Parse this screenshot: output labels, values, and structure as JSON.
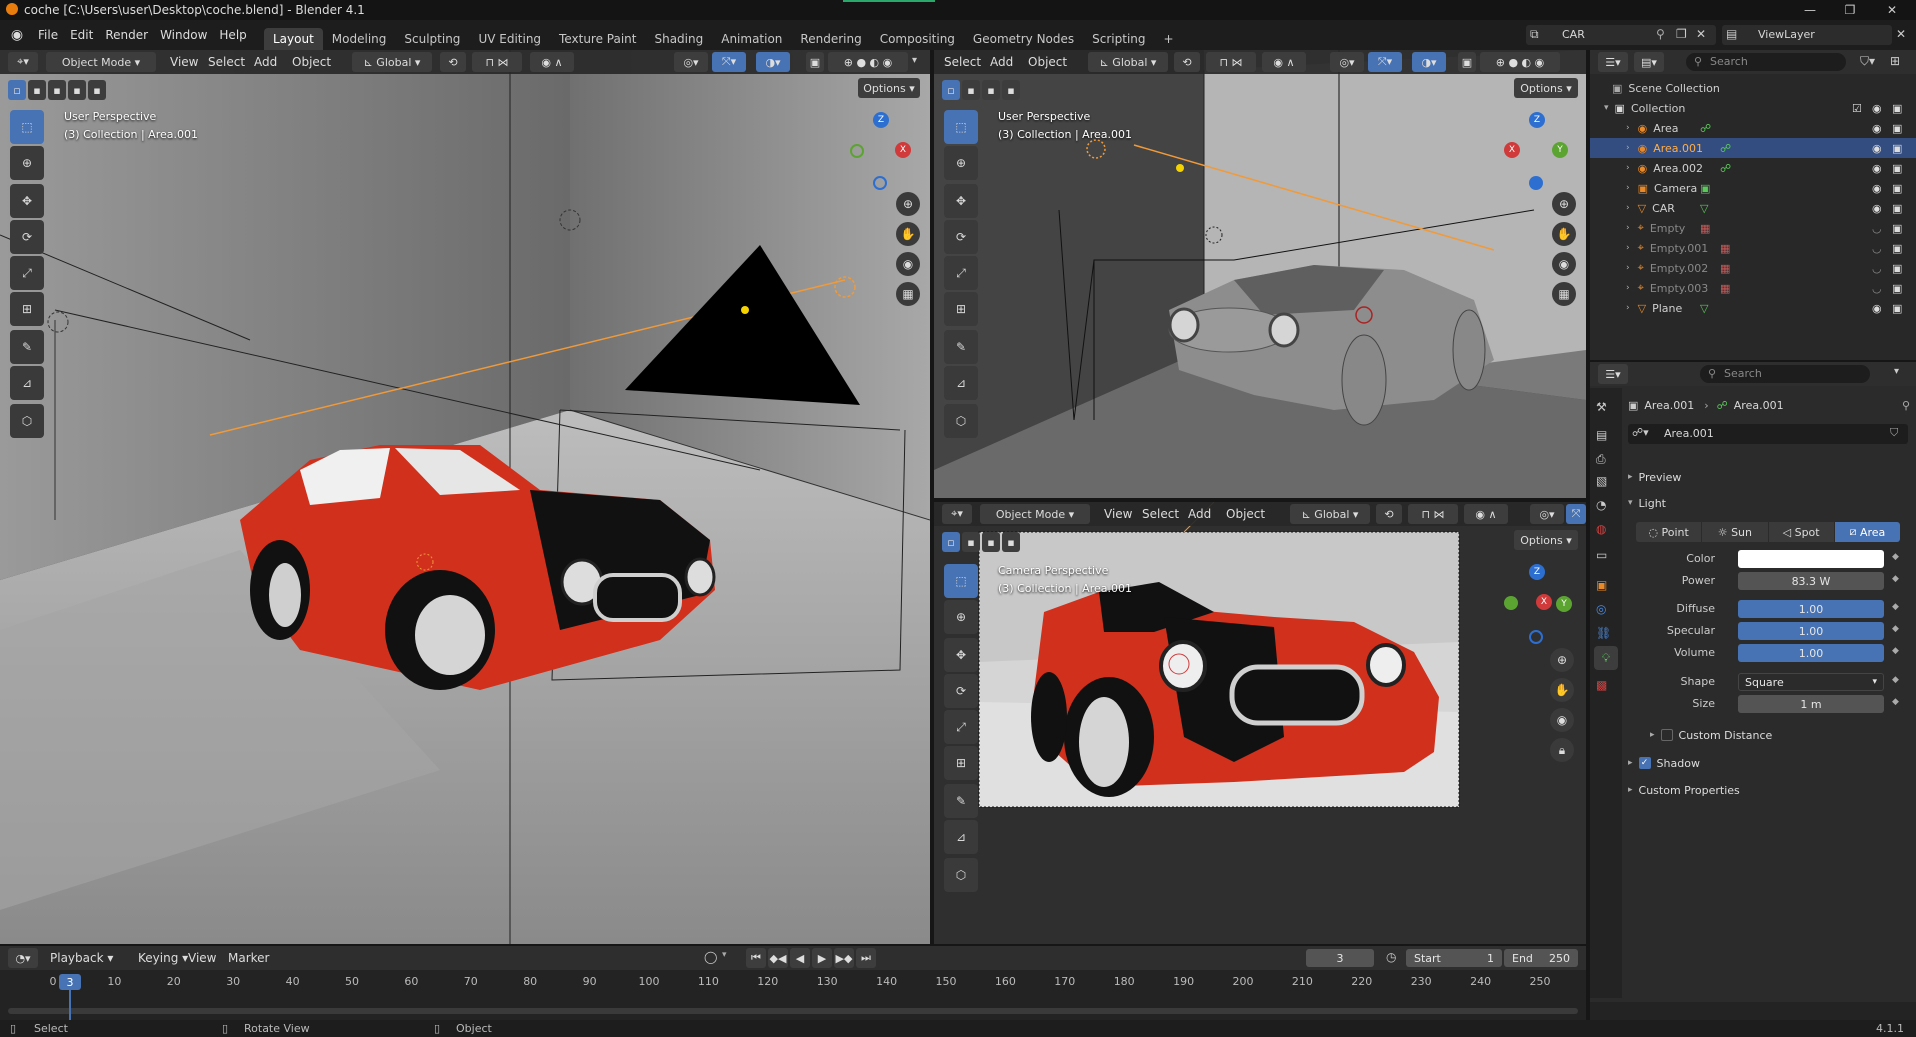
{
  "window": {
    "title": "coche [C:\\Users\\user\\Desktop\\coche.blend] - Blender 4.1"
  },
  "menu": [
    "File",
    "Edit",
    "Render",
    "Window",
    "Help"
  ],
  "workspaces": [
    "Layout",
    "Modeling",
    "Sculpting",
    "UV Editing",
    "Texture Paint",
    "Shading",
    "Animation",
    "Rendering",
    "Compositing",
    "Geometry Nodes",
    "Scripting"
  ],
  "active_workspace": "Layout",
  "scene": {
    "name": "CAR",
    "view_layer": "ViewLayer"
  },
  "viewport_main": {
    "mode": "Object Mode",
    "menus": [
      "View",
      "Select",
      "Add",
      "Object"
    ],
    "orientation": "Global",
    "options": "Options",
    "perspective": "User Perspective",
    "collection": "(3) Collection | Area.001"
  },
  "viewport_tr": {
    "menus": [
      "Select",
      "Add",
      "Object"
    ],
    "orientation": "Global",
    "options": "Options",
    "perspective": "User Perspective",
    "collection": "(3) Collection | Area.001"
  },
  "viewport_br": {
    "mode": "Object Mode",
    "menus": [
      "View",
      "Select",
      "Add",
      "Object"
    ],
    "orientation": "Global",
    "options": "Options",
    "perspective": "Camera Perspective",
    "collection": "(3) Collection | Area.001"
  },
  "gizmo": {
    "z": "Z",
    "x": "X",
    "y": "Y"
  },
  "outliner": {
    "search_placeholder": "Search",
    "scene_collection": "Scene Collection",
    "collection": "Collection",
    "items": [
      {
        "name": "Area",
        "type": "light"
      },
      {
        "name": "Area.001",
        "type": "light",
        "selected": true
      },
      {
        "name": "Area.002",
        "type": "light"
      },
      {
        "name": "Camera",
        "type": "camera"
      },
      {
        "name": "CAR",
        "type": "mesh"
      },
      {
        "name": "Empty",
        "type": "empty"
      },
      {
        "name": "Empty.001",
        "type": "empty"
      },
      {
        "name": "Empty.002",
        "type": "empty"
      },
      {
        "name": "Empty.003",
        "type": "empty"
      },
      {
        "name": "Plane",
        "type": "mesh"
      }
    ]
  },
  "properties": {
    "search_placeholder": "Search",
    "breadcrumb_object": "Area.001",
    "breadcrumb_data": "Area.001",
    "data_name": "Area.001",
    "preview": "Preview",
    "light": "Light",
    "light_types": [
      "Point",
      "Sun",
      "Spot",
      "Area"
    ],
    "active_type": "Area",
    "color_label": "Color",
    "power_label": "Power",
    "power": "83.3 W",
    "diffuse_label": "Diffuse",
    "diffuse": "1.00",
    "specular_label": "Specular",
    "specular": "1.00",
    "volume_label": "Volume",
    "volume": "1.00",
    "shape_label": "Shape",
    "shape": "Square",
    "size_label": "Size",
    "size": "1 m",
    "custom_distance": "Custom Distance",
    "shadow": "Shadow",
    "custom_properties": "Custom Properties"
  },
  "timeline": {
    "menus": [
      "Playback",
      "Keying",
      "View",
      "Marker"
    ],
    "current_frame": "3",
    "start_label": "Start",
    "start": "1",
    "end_label": "End",
    "end": "250",
    "ticks": [
      "0",
      "10",
      "20",
      "30",
      "40",
      "50",
      "60",
      "70",
      "80",
      "90",
      "100",
      "110",
      "120",
      "130",
      "140",
      "150",
      "160",
      "170",
      "180",
      "190",
      "200",
      "210",
      "220",
      "230",
      "240",
      "250"
    ]
  },
  "status": {
    "select": "Select",
    "rotate": "Rotate View",
    "object": "Object",
    "version": "4.1.1"
  },
  "colors": {
    "accent": "#4772b3",
    "car_red": "#d0301c",
    "light_orange": "#f09a3a"
  }
}
